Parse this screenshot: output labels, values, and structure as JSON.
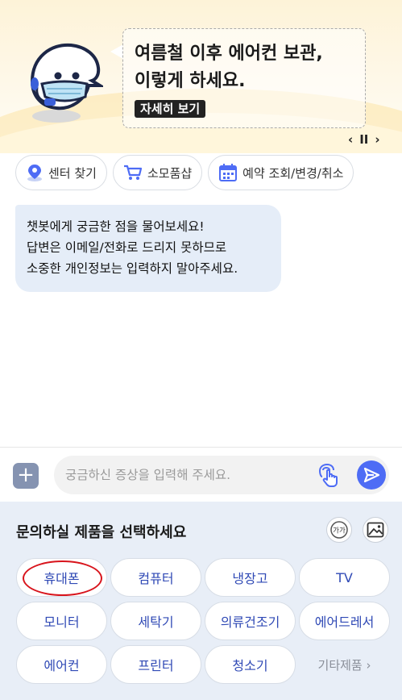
{
  "banner": {
    "title_line1": "여름철 이후 에어컨 보관,",
    "title_line2": "이렇게 하세요.",
    "detail_label": "자세히 보기",
    "prev_label": "‹",
    "pause_label": "II",
    "next_label": "›"
  },
  "quick_buttons": [
    {
      "label": "센터 찾기",
      "icon": "location-pin-icon"
    },
    {
      "label": "소모품샵",
      "icon": "cart-icon"
    },
    {
      "label": "예약 조회/변경/취소",
      "icon": "calendar-icon"
    }
  ],
  "chat": {
    "line1": "챗봇에게 궁금한 점을 물어보세요!",
    "line2": "답변은 이메일/전화로 드리지 못하므로",
    "line3": "소중한 개인정보는 입력하지 말아주세요."
  },
  "input": {
    "placeholder": "궁금하신 증상을 입력해 주세요.",
    "value": "",
    "plus_label": "+"
  },
  "panel": {
    "title": "문의하실 제품을 선택하세요",
    "font_size_icon_label": "가가",
    "products": [
      "휴대폰",
      "컴퓨터",
      "냉장고",
      "TV",
      "모니터",
      "세탁기",
      "의류건조기",
      "에어드레서",
      "에어컨",
      "프린터",
      "청소기"
    ],
    "more_label": "기타제품 ›"
  },
  "colors": {
    "accent": "#4e6cf5",
    "product_text": "#2f49b5",
    "bubble_bg": "#e5edf8",
    "panel_bg": "#e8eef7",
    "highlight_circle": "#d8141c"
  }
}
